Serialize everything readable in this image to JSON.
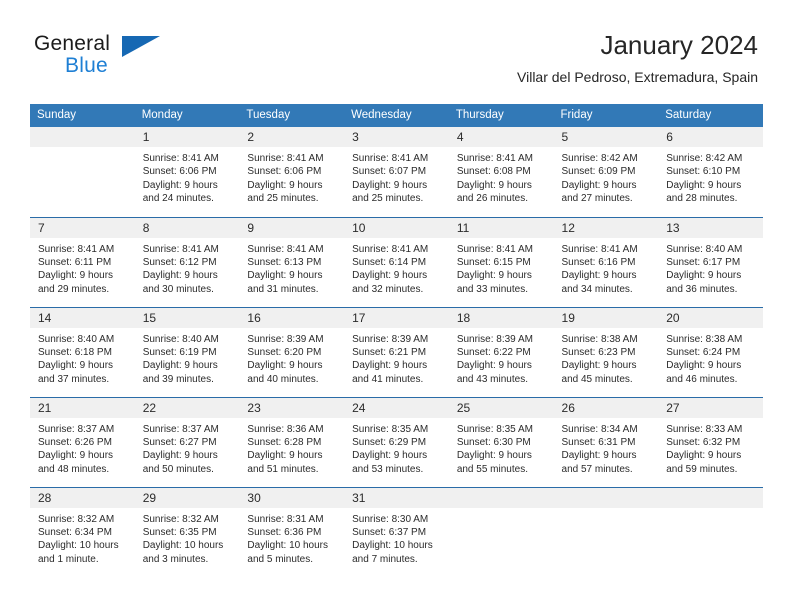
{
  "brand": {
    "name_part1": "General",
    "name_part2": "Blue",
    "logo_icon": "blue-triangle-flag"
  },
  "header": {
    "title": "January 2024",
    "subtitle": "Villar del Pedroso, Extremadura, Spain"
  },
  "colors": {
    "header_blue": "#3279b7",
    "row_divider_blue": "#2a6ca8",
    "daynum_band": "#f0f0f0",
    "brand_blue": "#1e7fd4",
    "text": "#2b2b2b"
  },
  "weekday_headers": [
    "Sunday",
    "Monday",
    "Tuesday",
    "Wednesday",
    "Thursday",
    "Friday",
    "Saturday"
  ],
  "weeks": [
    [
      {
        "day": "",
        "empty": true,
        "sunrise": "",
        "sunset": "",
        "daylight_line1": "",
        "daylight_line2": ""
      },
      {
        "day": "1",
        "empty": false,
        "sunrise": "Sunrise: 8:41 AM",
        "sunset": "Sunset: 6:06 PM",
        "daylight_line1": "Daylight: 9 hours",
        "daylight_line2": "and 24 minutes."
      },
      {
        "day": "2",
        "empty": false,
        "sunrise": "Sunrise: 8:41 AM",
        "sunset": "Sunset: 6:06 PM",
        "daylight_line1": "Daylight: 9 hours",
        "daylight_line2": "and 25 minutes."
      },
      {
        "day": "3",
        "empty": false,
        "sunrise": "Sunrise: 8:41 AM",
        "sunset": "Sunset: 6:07 PM",
        "daylight_line1": "Daylight: 9 hours",
        "daylight_line2": "and 25 minutes."
      },
      {
        "day": "4",
        "empty": false,
        "sunrise": "Sunrise: 8:41 AM",
        "sunset": "Sunset: 6:08 PM",
        "daylight_line1": "Daylight: 9 hours",
        "daylight_line2": "and 26 minutes."
      },
      {
        "day": "5",
        "empty": false,
        "sunrise": "Sunrise: 8:42 AM",
        "sunset": "Sunset: 6:09 PM",
        "daylight_line1": "Daylight: 9 hours",
        "daylight_line2": "and 27 minutes."
      },
      {
        "day": "6",
        "empty": false,
        "sunrise": "Sunrise: 8:42 AM",
        "sunset": "Sunset: 6:10 PM",
        "daylight_line1": "Daylight: 9 hours",
        "daylight_line2": "and 28 minutes."
      }
    ],
    [
      {
        "day": "7",
        "empty": false,
        "sunrise": "Sunrise: 8:41 AM",
        "sunset": "Sunset: 6:11 PM",
        "daylight_line1": "Daylight: 9 hours",
        "daylight_line2": "and 29 minutes."
      },
      {
        "day": "8",
        "empty": false,
        "sunrise": "Sunrise: 8:41 AM",
        "sunset": "Sunset: 6:12 PM",
        "daylight_line1": "Daylight: 9 hours",
        "daylight_line2": "and 30 minutes."
      },
      {
        "day": "9",
        "empty": false,
        "sunrise": "Sunrise: 8:41 AM",
        "sunset": "Sunset: 6:13 PM",
        "daylight_line1": "Daylight: 9 hours",
        "daylight_line2": "and 31 minutes."
      },
      {
        "day": "10",
        "empty": false,
        "sunrise": "Sunrise: 8:41 AM",
        "sunset": "Sunset: 6:14 PM",
        "daylight_line1": "Daylight: 9 hours",
        "daylight_line2": "and 32 minutes."
      },
      {
        "day": "11",
        "empty": false,
        "sunrise": "Sunrise: 8:41 AM",
        "sunset": "Sunset: 6:15 PM",
        "daylight_line1": "Daylight: 9 hours",
        "daylight_line2": "and 33 minutes."
      },
      {
        "day": "12",
        "empty": false,
        "sunrise": "Sunrise: 8:41 AM",
        "sunset": "Sunset: 6:16 PM",
        "daylight_line1": "Daylight: 9 hours",
        "daylight_line2": "and 34 minutes."
      },
      {
        "day": "13",
        "empty": false,
        "sunrise": "Sunrise: 8:40 AM",
        "sunset": "Sunset: 6:17 PM",
        "daylight_line1": "Daylight: 9 hours",
        "daylight_line2": "and 36 minutes."
      }
    ],
    [
      {
        "day": "14",
        "empty": false,
        "sunrise": "Sunrise: 8:40 AM",
        "sunset": "Sunset: 6:18 PM",
        "daylight_line1": "Daylight: 9 hours",
        "daylight_line2": "and 37 minutes."
      },
      {
        "day": "15",
        "empty": false,
        "sunrise": "Sunrise: 8:40 AM",
        "sunset": "Sunset: 6:19 PM",
        "daylight_line1": "Daylight: 9 hours",
        "daylight_line2": "and 39 minutes."
      },
      {
        "day": "16",
        "empty": false,
        "sunrise": "Sunrise: 8:39 AM",
        "sunset": "Sunset: 6:20 PM",
        "daylight_line1": "Daylight: 9 hours",
        "daylight_line2": "and 40 minutes."
      },
      {
        "day": "17",
        "empty": false,
        "sunrise": "Sunrise: 8:39 AM",
        "sunset": "Sunset: 6:21 PM",
        "daylight_line1": "Daylight: 9 hours",
        "daylight_line2": "and 41 minutes."
      },
      {
        "day": "18",
        "empty": false,
        "sunrise": "Sunrise: 8:39 AM",
        "sunset": "Sunset: 6:22 PM",
        "daylight_line1": "Daylight: 9 hours",
        "daylight_line2": "and 43 minutes."
      },
      {
        "day": "19",
        "empty": false,
        "sunrise": "Sunrise: 8:38 AM",
        "sunset": "Sunset: 6:23 PM",
        "daylight_line1": "Daylight: 9 hours",
        "daylight_line2": "and 45 minutes."
      },
      {
        "day": "20",
        "empty": false,
        "sunrise": "Sunrise: 8:38 AM",
        "sunset": "Sunset: 6:24 PM",
        "daylight_line1": "Daylight: 9 hours",
        "daylight_line2": "and 46 minutes."
      }
    ],
    [
      {
        "day": "21",
        "empty": false,
        "sunrise": "Sunrise: 8:37 AM",
        "sunset": "Sunset: 6:26 PM",
        "daylight_line1": "Daylight: 9 hours",
        "daylight_line2": "and 48 minutes."
      },
      {
        "day": "22",
        "empty": false,
        "sunrise": "Sunrise: 8:37 AM",
        "sunset": "Sunset: 6:27 PM",
        "daylight_line1": "Daylight: 9 hours",
        "daylight_line2": "and 50 minutes."
      },
      {
        "day": "23",
        "empty": false,
        "sunrise": "Sunrise: 8:36 AM",
        "sunset": "Sunset: 6:28 PM",
        "daylight_line1": "Daylight: 9 hours",
        "daylight_line2": "and 51 minutes."
      },
      {
        "day": "24",
        "empty": false,
        "sunrise": "Sunrise: 8:35 AM",
        "sunset": "Sunset: 6:29 PM",
        "daylight_line1": "Daylight: 9 hours",
        "daylight_line2": "and 53 minutes."
      },
      {
        "day": "25",
        "empty": false,
        "sunrise": "Sunrise: 8:35 AM",
        "sunset": "Sunset: 6:30 PM",
        "daylight_line1": "Daylight: 9 hours",
        "daylight_line2": "and 55 minutes."
      },
      {
        "day": "26",
        "empty": false,
        "sunrise": "Sunrise: 8:34 AM",
        "sunset": "Sunset: 6:31 PM",
        "daylight_line1": "Daylight: 9 hours",
        "daylight_line2": "and 57 minutes."
      },
      {
        "day": "27",
        "empty": false,
        "sunrise": "Sunrise: 8:33 AM",
        "sunset": "Sunset: 6:32 PM",
        "daylight_line1": "Daylight: 9 hours",
        "daylight_line2": "and 59 minutes."
      }
    ],
    [
      {
        "day": "28",
        "empty": false,
        "sunrise": "Sunrise: 8:32 AM",
        "sunset": "Sunset: 6:34 PM",
        "daylight_line1": "Daylight: 10 hours",
        "daylight_line2": "and 1 minute."
      },
      {
        "day": "29",
        "empty": false,
        "sunrise": "Sunrise: 8:32 AM",
        "sunset": "Sunset: 6:35 PM",
        "daylight_line1": "Daylight: 10 hours",
        "daylight_line2": "and 3 minutes."
      },
      {
        "day": "30",
        "empty": false,
        "sunrise": "Sunrise: 8:31 AM",
        "sunset": "Sunset: 6:36 PM",
        "daylight_line1": "Daylight: 10 hours",
        "daylight_line2": "and 5 minutes."
      },
      {
        "day": "31",
        "empty": false,
        "sunrise": "Sunrise: 8:30 AM",
        "sunset": "Sunset: 6:37 PM",
        "daylight_line1": "Daylight: 10 hours",
        "daylight_line2": "and 7 minutes."
      },
      {
        "day": "",
        "empty": true,
        "sunrise": "",
        "sunset": "",
        "daylight_line1": "",
        "daylight_line2": ""
      },
      {
        "day": "",
        "empty": true,
        "sunrise": "",
        "sunset": "",
        "daylight_line1": "",
        "daylight_line2": ""
      },
      {
        "day": "",
        "empty": true,
        "sunrise": "",
        "sunset": "",
        "daylight_line1": "",
        "daylight_line2": ""
      }
    ]
  ]
}
